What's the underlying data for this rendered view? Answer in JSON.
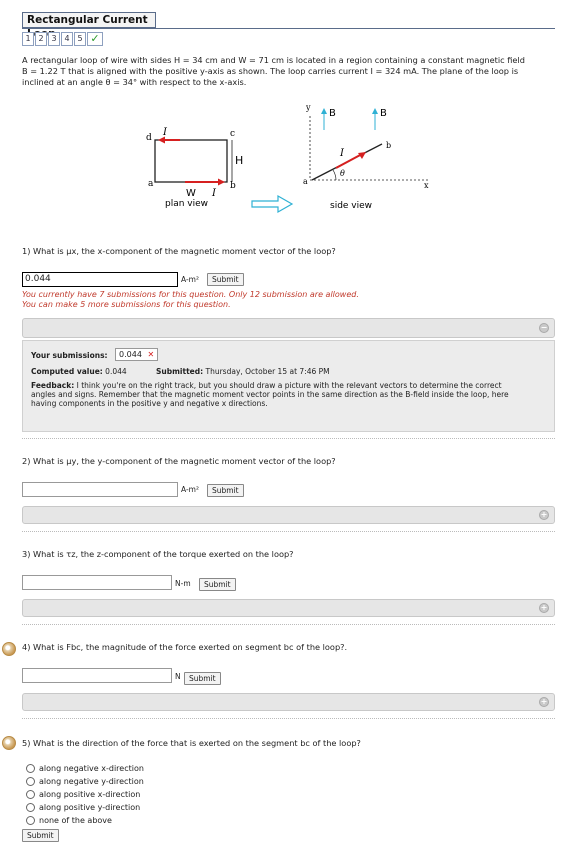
{
  "header": {
    "title": "Rectangular Current Loop",
    "steps": [
      "1",
      "2",
      "3",
      "4",
      "5"
    ],
    "check_icon": "checkmark-icon"
  },
  "problem": {
    "line1": "A rectangular loop of wire with sides H = 34 cm and W = 71 cm is located in a region containing a constant magnetic field",
    "line2": "B = 1.22 T that is aligned with the positive y-axis as shown. The loop carries current I = 324 mA. The plane of the loop is",
    "line3": "inclined at an angle θ = 34° with respect to the x-axis."
  },
  "figure": {
    "plan_label": "plan view",
    "side_label": "side view",
    "labels": {
      "d": "d",
      "c": "c",
      "a": "a",
      "b": "b",
      "H": "H",
      "W": "W",
      "I": "I",
      "B": "B",
      "y": "y",
      "x": "x",
      "theta": "θ"
    }
  },
  "q1": {
    "text": "1) What is μx, the x-component of the magnetic moment vector of the loop?",
    "value": "0.044",
    "unit": "A-m²",
    "submit": "Submit",
    "warn1": "You currently have 7 submissions for this question. Only 12 submission are allowed.",
    "warn2": "You can make 5 more submissions for this question.",
    "your_submissions_label": "Your submissions:",
    "submitted_value": "0.044",
    "computed_label": "Computed value:",
    "computed_value": "0.044",
    "submitted_label": "Submitted:",
    "submitted_time": "Thursday, October 15 at 7:46 PM",
    "feedback_label": "Feedback:",
    "feedback_line1": "I think you're on the right track, but you should draw a picture with the relevant vectors to determine the correct",
    "feedback_line2": "angles and signs. Remember that the magnetic moment vector points in the same direction as the B-field inside the loop, here",
    "feedback_line3": "having components in the positive y and negative x directions."
  },
  "q2": {
    "text": "2) What is μy, the y-component of the magnetic moment vector of the loop?",
    "value": "",
    "unit": "A-m²",
    "submit": "Submit"
  },
  "q3": {
    "text": "3) What is τz, the z-component of the torque exerted on the loop?",
    "value": "",
    "unit": "N-m",
    "submit": "Submit"
  },
  "q4": {
    "text": "4) What is Fbc, the magnitude of the force exerted on segment bc of the loop?.",
    "value": "",
    "unit": "N",
    "submit": "Submit"
  },
  "q5": {
    "text": "5) What is the direction of the force that is exerted on the segment bc of the loop?",
    "options": [
      "along negative x-direction",
      "along negative y-direction",
      "along positive x-direction",
      "along positive y-direction",
      "none of the above"
    ],
    "submit": "Submit"
  },
  "colors": {
    "frame": "#5a6c8a",
    "warn": "#c0392b",
    "figure_red": "#d62020",
    "figure_arrow": "#2fb1d4"
  }
}
